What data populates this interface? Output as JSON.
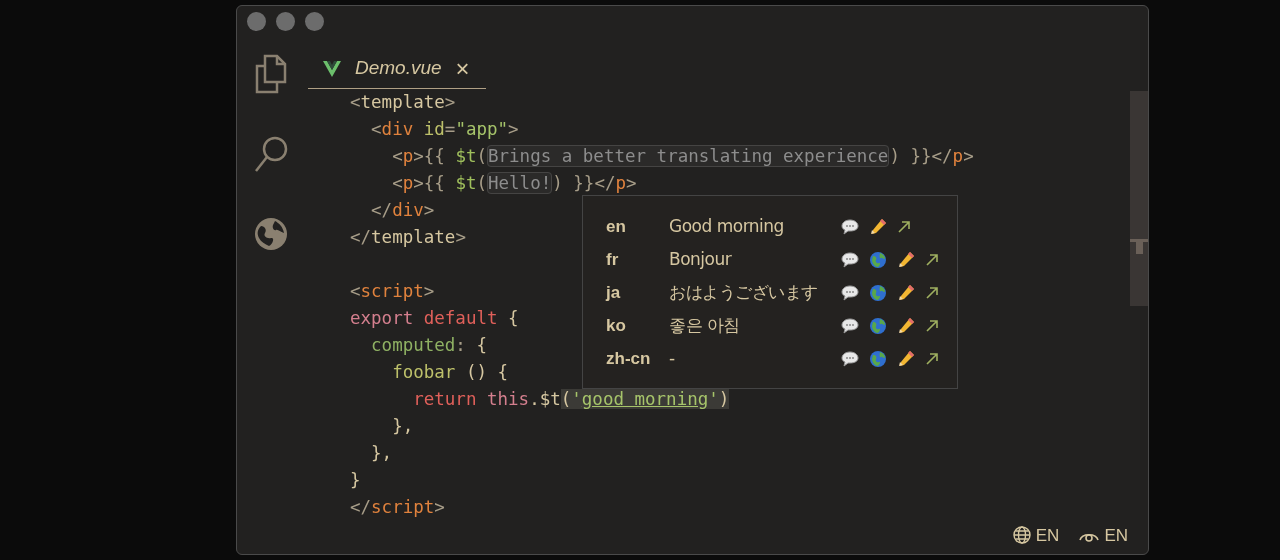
{
  "tab": {
    "title": "Demo.vue",
    "close": "×"
  },
  "code": [
    {
      "kind": "code",
      "tokens": [
        {
          "text": "<",
          "kind": "punct"
        },
        {
          "text": "template",
          "kind": "text"
        },
        {
          "text": ">",
          "kind": "punct"
        }
      ]
    },
    {
      "kind": "code",
      "tokens": [
        {
          "text": "  <",
          "kind": "punct"
        },
        {
          "text": "div",
          "kind": "tag"
        },
        {
          "text": " id",
          "kind": "attr"
        },
        {
          "text": "=",
          "kind": "punct"
        },
        {
          "text": "\"app\"",
          "kind": "string"
        },
        {
          "text": ">",
          "kind": "punct"
        }
      ]
    },
    {
      "kind": "code",
      "tokens": [
        {
          "text": "    <",
          "kind": "punct"
        },
        {
          "text": "p",
          "kind": "tag"
        },
        {
          "text": ">{{ ",
          "kind": "punct"
        },
        {
          "text": "$t",
          "kind": "func"
        },
        {
          "text": "(",
          "kind": "punct"
        },
        {
          "text": "Brings a better translating experience",
          "kind": "hint"
        },
        {
          "text": ") }}</",
          "kind": "punct"
        },
        {
          "text": "p",
          "kind": "tag"
        },
        {
          "text": ">",
          "kind": "punct"
        }
      ]
    },
    {
      "kind": "code",
      "tokens": [
        {
          "text": "    <",
          "kind": "punct"
        },
        {
          "text": "p",
          "kind": "tag"
        },
        {
          "text": ">{{ ",
          "kind": "punct"
        },
        {
          "text": "$t",
          "kind": "func"
        },
        {
          "text": "(",
          "kind": "punct"
        },
        {
          "text": "Hello!",
          "kind": "hint"
        },
        {
          "text": ") }}</",
          "kind": "punct"
        },
        {
          "text": "p",
          "kind": "tag"
        },
        {
          "text": ">",
          "kind": "punct"
        }
      ]
    },
    {
      "kind": "code",
      "tokens": [
        {
          "text": "  </",
          "kind": "punct"
        },
        {
          "text": "div",
          "kind": "tag"
        },
        {
          "text": ">",
          "kind": "punct"
        }
      ]
    },
    {
      "kind": "code",
      "tokens": [
        {
          "text": "</",
          "kind": "punct"
        },
        {
          "text": "template",
          "kind": "text"
        },
        {
          "text": ">",
          "kind": "punct"
        }
      ]
    },
    {
      "kind": "blank"
    },
    {
      "kind": "code",
      "tokens": [
        {
          "text": "<",
          "kind": "punct"
        },
        {
          "text": "script",
          "kind": "tag"
        },
        {
          "text": ">",
          "kind": "punct"
        }
      ]
    },
    {
      "kind": "code",
      "tokens": [
        {
          "text": "export",
          "kind": "keyword"
        },
        {
          "text": " default",
          "kind": "keyword2"
        },
        {
          "text": " {",
          "kind": "text"
        }
      ]
    },
    {
      "kind": "code",
      "tokens": [
        {
          "text": "  computed",
          "kind": "key"
        },
        {
          "text": ":",
          "kind": "punct"
        },
        {
          "text": " {",
          "kind": "text"
        }
      ]
    },
    {
      "kind": "code",
      "tokens": [
        {
          "text": "    foobar",
          "kind": "attr"
        },
        {
          "text": " () {",
          "kind": "text"
        }
      ]
    },
    {
      "kind": "code",
      "tokens": [
        {
          "text": "      return",
          "kind": "keyword2"
        },
        {
          "text": " this",
          "kind": "keyword"
        },
        {
          "text": ".$t",
          "kind": "text"
        },
        {
          "text": "(",
          "kind": "hl_punct"
        },
        {
          "text": "'",
          "kind": "hl_string"
        },
        {
          "text": "good morning",
          "kind": "hl_key"
        },
        {
          "text": "'",
          "kind": "hl_string"
        },
        {
          "text": ")",
          "kind": "hl_punct"
        }
      ]
    },
    {
      "kind": "code",
      "tokens": [
        {
          "text": "    },",
          "kind": "text"
        }
      ]
    },
    {
      "kind": "code",
      "tokens": [
        {
          "text": "  },",
          "kind": "text"
        }
      ]
    },
    {
      "kind": "code",
      "tokens": [
        {
          "text": "}",
          "kind": "text"
        }
      ]
    },
    {
      "kind": "code",
      "tokens": [
        {
          "text": "</",
          "kind": "punct"
        },
        {
          "text": "script",
          "kind": "tag"
        },
        {
          "text": ">",
          "kind": "punct"
        }
      ]
    }
  ],
  "translations": [
    {
      "locale": "en",
      "text": "Good morning",
      "icons": [
        {
          "kind": "comment"
        },
        {
          "kind": "edit"
        },
        {
          "kind": "open"
        }
      ]
    },
    {
      "locale": "fr",
      "text": "Bonjour",
      "icons": [
        {
          "kind": "comment"
        },
        {
          "kind": "translate"
        },
        {
          "kind": "edit"
        },
        {
          "kind": "open"
        }
      ]
    },
    {
      "locale": "ja",
      "text": "おはようございます",
      "icons": [
        {
          "kind": "comment"
        },
        {
          "kind": "translate"
        },
        {
          "kind": "edit"
        },
        {
          "kind": "open"
        }
      ]
    },
    {
      "locale": "ko",
      "text": "좋은 아침",
      "icons": [
        {
          "kind": "comment"
        },
        {
          "kind": "translate"
        },
        {
          "kind": "edit"
        },
        {
          "kind": "open"
        }
      ]
    },
    {
      "locale": "zh-cn",
      "text": "-",
      "icons": [
        {
          "kind": "comment"
        },
        {
          "kind": "translate"
        },
        {
          "kind": "edit"
        },
        {
          "kind": "open"
        }
      ]
    }
  ],
  "status_bar": [
    {
      "kind": "locale",
      "text": "EN"
    },
    {
      "kind": "display",
      "text": "EN"
    }
  ]
}
